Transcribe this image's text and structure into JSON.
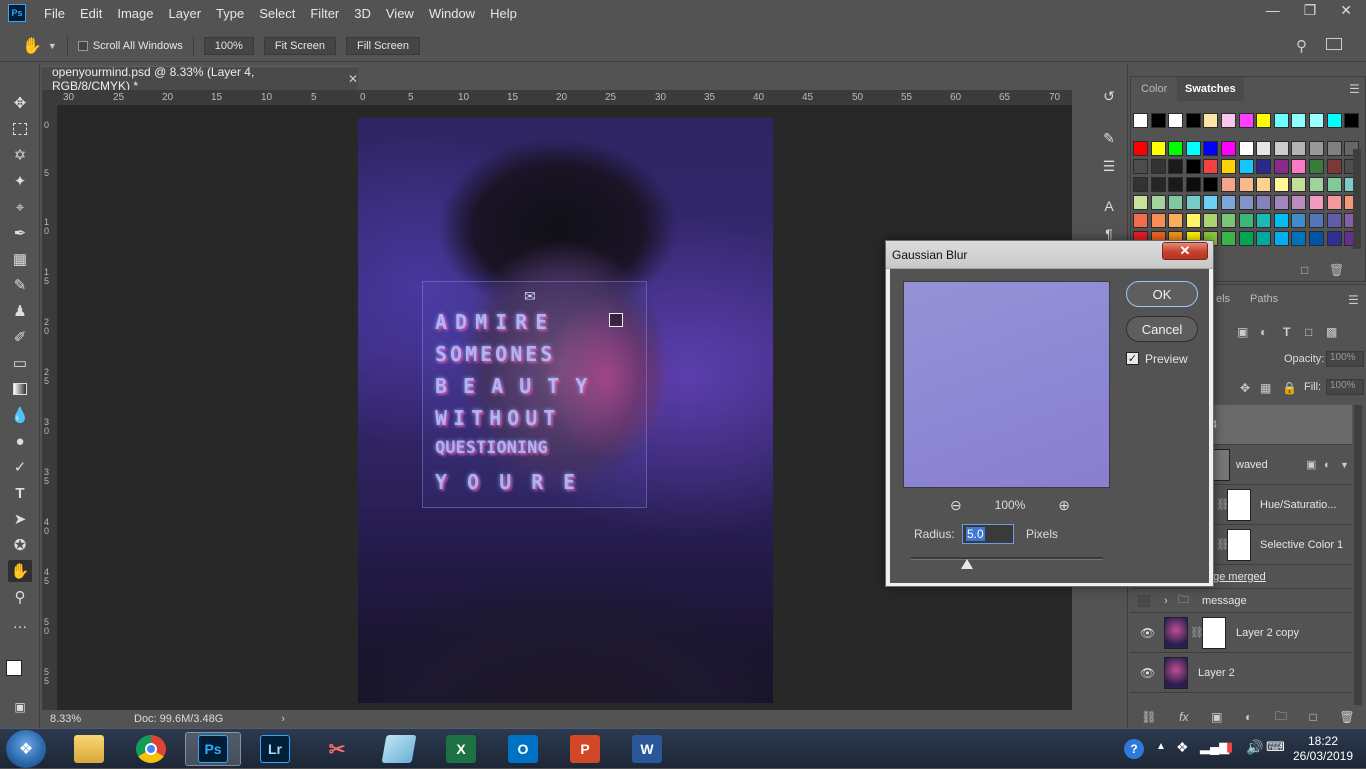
{
  "app": {
    "logo": "Ps",
    "menu": [
      "File",
      "Edit",
      "Image",
      "Layer",
      "Type",
      "Select",
      "Filter",
      "3D",
      "View",
      "Window",
      "Help"
    ]
  },
  "options_bar": {
    "scroll_all_windows": "Scroll All Windows",
    "zoom_100": "100%",
    "fit_screen": "Fit Screen",
    "fill_screen": "Fill Screen"
  },
  "document": {
    "tab_title": "openyourmind.psd @ 8.33% (Layer 4, RGB/8/CMYK) *",
    "ruler_top": [
      "30",
      "25",
      "20",
      "15",
      "10",
      "5",
      "0",
      "5",
      "10",
      "15",
      "20",
      "25",
      "30",
      "35",
      "40",
      "45",
      "50",
      "55",
      "60",
      "65",
      "70"
    ],
    "ruler_left": [
      "0",
      "5",
      "1\n0",
      "1\n5",
      "2\n0",
      "2\n5",
      "3\n0",
      "3\n5",
      "4\n0",
      "4\n5",
      "5\n0",
      "5\n5"
    ],
    "canvas_text": [
      "ADMIRE",
      "SOMEONES",
      "BEAUTY",
      "WITHOUT",
      "QUESTIONING",
      "YOURE"
    ]
  },
  "status": {
    "zoom": "8.33%",
    "doc": "Doc: 99.6M/3.48G"
  },
  "swatches_panel": {
    "tabs": [
      "Color",
      "Swatches"
    ],
    "active_tab": "Swatches",
    "colors": [
      "#ffffff",
      "#000000",
      "#ffffff",
      "#000000",
      "#fde5a5",
      "#f7c7ee",
      "#ff40ff",
      "#ffff00",
      "#67ffff",
      "#8effff",
      "#99ffff",
      "#00ffff",
      "#000000",
      "#ff0000",
      "#ffff00",
      "#00ff00",
      "#00ffff",
      "#0000ff",
      "#ff00ff",
      "#ffffff",
      "#e6e6e6",
      "#cccccc",
      "#b3b3b3",
      "#999999",
      "#808080",
      "#666666",
      "#4d4d4d",
      "#333333",
      "#1a1a1a",
      "#000000",
      "#f34242",
      "#ffd300",
      "#14c8ff",
      "#2a2a8c",
      "#8c2a8c",
      "#ff7ac6",
      "#3a7a3a",
      "#7a3a3a",
      "#4d4d4d",
      "#333333",
      "#262626",
      "#1a1a1a",
      "#0d0d0d",
      "#000000",
      "#f7a589",
      "#f9b98d",
      "#fdd28d",
      "#fff799",
      "#c4df9b",
      "#a3d39c",
      "#82ca9c",
      "#7accc8",
      "#c9e19d",
      "#a3d49b",
      "#7fcaa1",
      "#77ccc8",
      "#6dcff6",
      "#7da7d9",
      "#8393ca",
      "#8781bd",
      "#a186be",
      "#bc8cbf",
      "#f49ac1",
      "#f5989d",
      "#f7977a",
      "#f26c4f",
      "#f68e55",
      "#fbaf5c",
      "#fff467",
      "#acd372",
      "#7cc576",
      "#3bb878",
      "#1abbb4",
      "#00bff3",
      "#438ccb",
      "#5574b9",
      "#605ca8",
      "#855fa8",
      "#ed1c24",
      "#f26522",
      "#f7941d",
      "#fff200",
      "#8dc73f",
      "#39b54a",
      "#00a651",
      "#00a99d",
      "#00aeef",
      "#0072bc",
      "#0054a6",
      "#2e3192",
      "#662d91"
    ]
  },
  "layers_panel": {
    "tabs": [
      "els",
      "Paths"
    ],
    "opacity_label": "Opacity:",
    "opacity_value": "100%",
    "fill_label": "Fill:",
    "fill_value": "100%",
    "layers": [
      {
        "name": "er 4",
        "selected": true
      },
      {
        "name": "waved"
      },
      {
        "name": "Hue/Saturatio..."
      },
      {
        "name": "Selective Color 1"
      },
      {
        "name": "ssage merged"
      },
      {
        "name": "message"
      },
      {
        "name": "Layer 2 copy"
      },
      {
        "name": "Layer 2"
      }
    ]
  },
  "dialog": {
    "title": "Gaussian Blur",
    "close": "✕",
    "ok": "OK",
    "cancel": "Cancel",
    "preview_label": "Preview",
    "preview_checked": true,
    "zoom": "100%",
    "radius_label": "Radius:",
    "radius_value": "5.0",
    "radius_unit": "Pixels",
    "radius_slider_fraction": 0.29
  },
  "taskbar": {
    "apps": [
      "File Explorer",
      "Chrome",
      "Ps",
      "Lr",
      "Snipping Tool",
      "Notepad",
      "X",
      "O",
      "P",
      "W"
    ],
    "time": "18:22",
    "date": "26/03/2019"
  }
}
